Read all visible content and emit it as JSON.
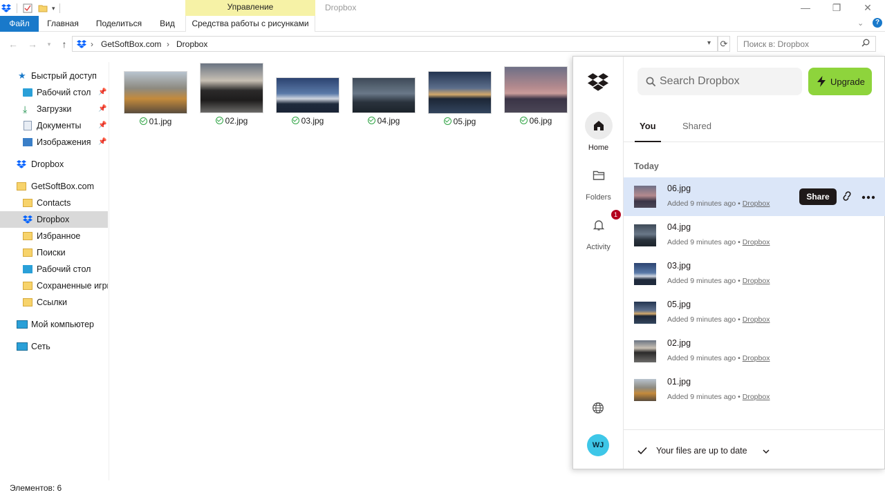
{
  "titlebar": {
    "manage_tab": "Управление",
    "window_title": "Dropbox"
  },
  "ribbon": {
    "file": "Файл",
    "home": "Главная",
    "share": "Поделиться",
    "view": "Вид",
    "picture_tools": "Средства работы с рисунками"
  },
  "address": {
    "segments": [
      "GetSoftBox.com",
      "Dropbox"
    ],
    "search_placeholder": "Поиск в: Dropbox"
  },
  "nav": {
    "quick_access": "Быстрый доступ",
    "quick_items": [
      "Рабочий стол",
      "Загрузки",
      "Документы",
      "Изображения"
    ],
    "dropbox": "Dropbox",
    "getsoftbox": "GetSoftBox.com",
    "sub_items": [
      "Contacts",
      "Dropbox",
      "Избранное",
      "Поиски",
      "Рабочий стол",
      "Сохраненные игры",
      "Ссылки"
    ],
    "my_computer": "Мой компьютер",
    "network": "Сеть"
  },
  "files": [
    "01.jpg",
    "02.jpg",
    "03.jpg",
    "04.jpg",
    "05.jpg",
    "06.jpg"
  ],
  "status_bar": "Элементов: 6",
  "dropbox_panel": {
    "rail": {
      "home": "Home",
      "folders": "Folders",
      "activity": "Activity",
      "activity_badge": "1",
      "avatar_initials": "WJ"
    },
    "search_placeholder": "Search Dropbox",
    "upgrade": "Upgrade",
    "tabs": [
      "You",
      "Shared"
    ],
    "section": "Today",
    "recent": [
      {
        "name": "06.jpg",
        "meta": "Added 9 minutes ago",
        "loc": "Dropbox"
      },
      {
        "name": "04.jpg",
        "meta": "Added 9 minutes ago",
        "loc": "Dropbox"
      },
      {
        "name": "03.jpg",
        "meta": "Added 9 minutes ago",
        "loc": "Dropbox"
      },
      {
        "name": "05.jpg",
        "meta": "Added 9 minutes ago",
        "loc": "Dropbox"
      },
      {
        "name": "02.jpg",
        "meta": "Added 9 minutes ago",
        "loc": "Dropbox"
      },
      {
        "name": "01.jpg",
        "meta": "Added 9 minutes ago",
        "loc": "Dropbox"
      }
    ],
    "share_button": "Share",
    "footer_status": "Your files are up to date"
  },
  "colors": {
    "file_tab": "#1979ca",
    "manage_tab": "#f6f2a6",
    "upgrade": "#8ed43c",
    "highlight_row": "#dbe6f8",
    "badge": "#b3001e",
    "avatar": "#3ec7e8"
  }
}
